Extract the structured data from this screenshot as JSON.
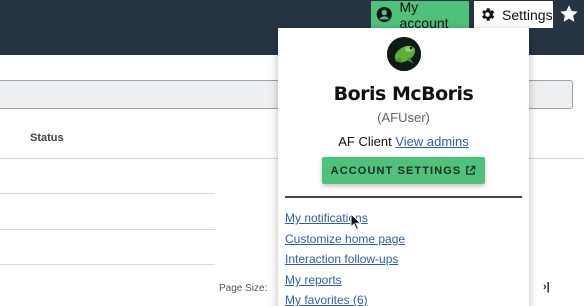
{
  "topbar": {
    "my_account_label": "My account",
    "settings_label": "Settings"
  },
  "table": {
    "status_header": "Status"
  },
  "pagination": {
    "page_size_label": "Page Size:",
    "last_page_symbol": "›|"
  },
  "account_menu": {
    "full_name": "Boris McBoris",
    "username": "(AFUser)",
    "client_label": "AF Client",
    "view_admins_link": "View admins",
    "account_settings_button": "ACCOUNT SETTINGS",
    "links": [
      "My notifications",
      "Customize home page",
      "Interaction follow-ups",
      "My reports",
      "My favorites (6)"
    ]
  },
  "icons": {
    "account": "account-circle-icon",
    "settings": "gear-icon",
    "favorite": "star-icon",
    "external": "external-link-icon"
  },
  "colors": {
    "topbar": "#263342",
    "accent_green": "#4fc17a",
    "link_blue": "#2e5fa8"
  }
}
